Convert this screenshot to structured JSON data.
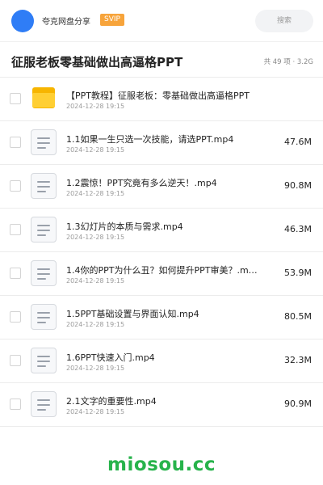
{
  "header": {
    "user_name": "夸克网盘分享",
    "badge": "SVIP",
    "search_placeholder": "搜索"
  },
  "title_row": {
    "title": "征服老板零基础做出高逼格PPT",
    "meta": "共 49 项 · 3.2G"
  },
  "files": [
    {
      "type": "folder",
      "name": "【PPT教程】征服老板：零基础做出高逼格PPT",
      "date": "2024-12-28 19:15",
      "size": ""
    },
    {
      "type": "file",
      "name": "1.1如果一生只选一次技能，请选PPT.mp4",
      "date": "2024-12-28 19:15",
      "size": "47.6M"
    },
    {
      "type": "file",
      "name": "1.2震惊！PPT究竟有多么逆天！.mp4",
      "date": "2024-12-28 19:15",
      "size": "90.8M"
    },
    {
      "type": "file",
      "name": "1.3幻灯片的本质与需求.mp4",
      "date": "2024-12-28 19:15",
      "size": "46.3M"
    },
    {
      "type": "file",
      "name": "1.4你的PPT为什么丑？如何提升PPT审美？.m…",
      "date": "2024-12-28 19:15",
      "size": "53.9M"
    },
    {
      "type": "file",
      "name": "1.5PPT基础设置与界面认知.mp4",
      "date": "2024-12-28 19:15",
      "size": "80.5M"
    },
    {
      "type": "file",
      "name": "1.6PPT快速入门.mp4",
      "date": "2024-12-28 19:15",
      "size": "32.3M"
    },
    {
      "type": "file",
      "name": "2.1文字的重要性.mp4",
      "date": "2024-12-28 19:15",
      "size": "90.9M"
    }
  ],
  "watermark": "miosou.cc",
  "colors": {
    "accent": "#2f7df6",
    "badge": "#f7a43b",
    "folder": "#ffcf33",
    "watermark": "#27b34b"
  }
}
